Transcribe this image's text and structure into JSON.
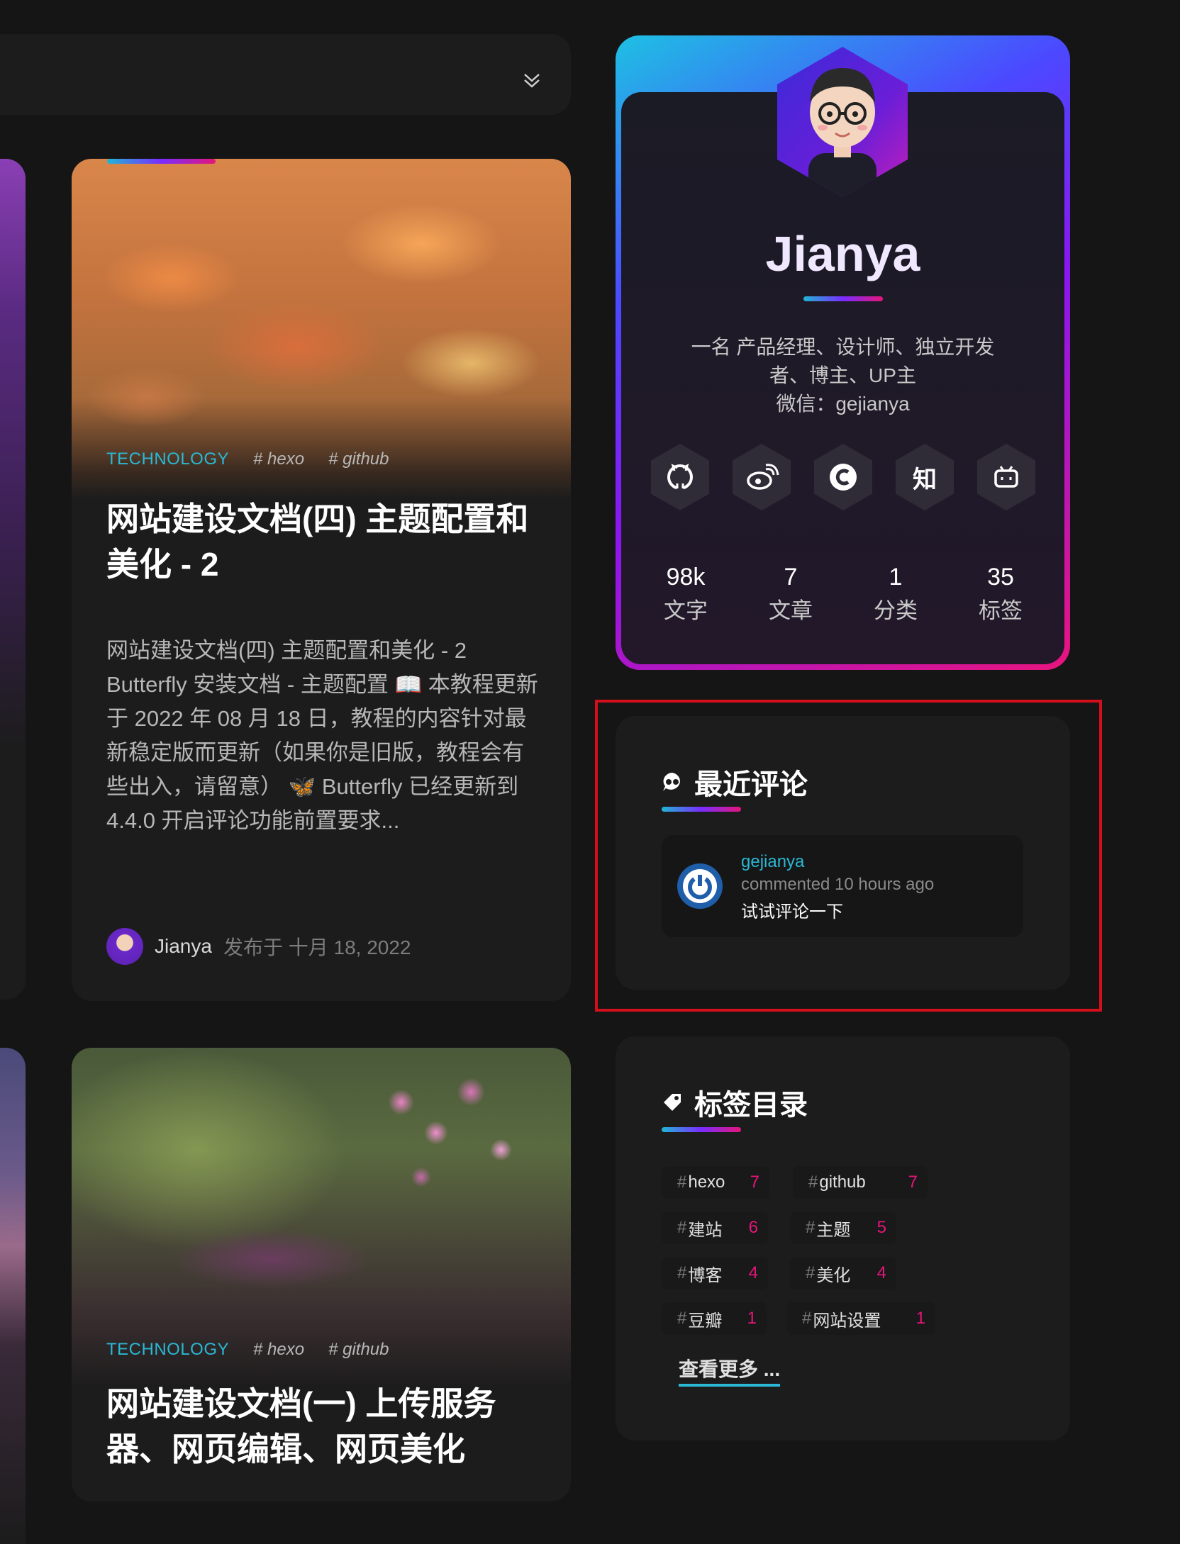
{
  "posts": [
    {
      "category": "TECHNOLOGY",
      "tags": [
        "# hexo",
        "# github"
      ],
      "title": "网站建设文档(四) 主题配置和美化 - 2",
      "excerpt": "网站建设文档(四) 主题配置和美化 - 2 Butterfly 安装文档 - 主题配置 📖 本教程更新于 2022 年 08 月 18 日，教程的内容针对最新稳定版而更新（如果你是旧版，教程会有些出入，请留意） 🦋 Butterfly 已经更新到 4.4.0 开启评论功能前置要求...",
      "author": "Jianya",
      "date": "发布于 十月 18, 2022"
    },
    {
      "category": "TECHNOLOGY",
      "tags": [
        "# hexo",
        "# github"
      ],
      "title": "网站建设文档(一) 上传服务器、网页编辑、网页美化"
    }
  ],
  "profile": {
    "name": "Jianya",
    "description": "一名 产品经理、设计师、独立开发者、博主、UP主\n微信：gejianya",
    "social": [
      {
        "icon": "github-icon",
        "glyph": ""
      },
      {
        "icon": "weibo-icon",
        "glyph": ""
      },
      {
        "icon": "c-icon",
        "glyph": "C"
      },
      {
        "icon": "zhihu-icon",
        "glyph": "知"
      },
      {
        "icon": "bilibili-icon",
        "glyph": ""
      }
    ],
    "stats": [
      {
        "value": "98k",
        "label": "文字"
      },
      {
        "value": "7",
        "label": "文章"
      },
      {
        "value": "1",
        "label": "分类"
      },
      {
        "value": "35",
        "label": "标签"
      }
    ]
  },
  "recent_comments": {
    "title": "最近评论",
    "items": [
      {
        "user": "gejianya",
        "when": "commented 10 hours ago",
        "text": "试试评论一下"
      }
    ]
  },
  "tag_directory": {
    "title": "标签目录",
    "tags": [
      {
        "name": "hexo",
        "count": "7"
      },
      {
        "name": "github",
        "count": "7"
      },
      {
        "name": "建站",
        "count": "6"
      },
      {
        "name": "主题",
        "count": "5"
      },
      {
        "name": "博客",
        "count": "4"
      },
      {
        "name": "美化",
        "count": "4"
      },
      {
        "name": "豆瓣",
        "count": "1"
      },
      {
        "name": "网站设置",
        "count": "1"
      }
    ],
    "more_label": "查看更多 ..."
  },
  "colors": {
    "accent_cyan": "#2ab8d4",
    "accent_pink": "#e5157a",
    "highlight_red": "#d20f1a",
    "background": "#151515",
    "card": "#1c1c1c"
  }
}
